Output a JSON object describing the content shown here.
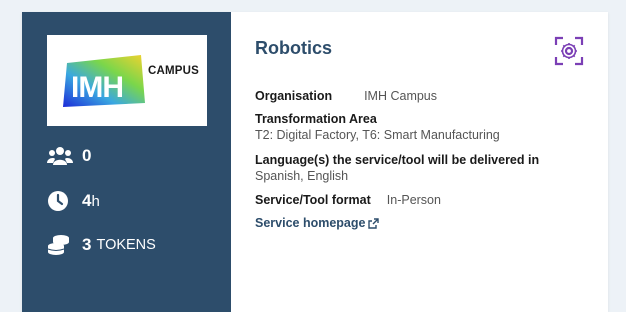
{
  "logo": {
    "letters": "IMH",
    "campus_text": "CAMPUS"
  },
  "stats": {
    "participants": "0",
    "duration_value": "4",
    "duration_unit": "h",
    "tokens_value": "3",
    "tokens_label": "TOKENS"
  },
  "title": "Robotics",
  "fields": {
    "organisation_label": "Organisation",
    "organisation_value": "IMH Campus",
    "area_label": "Transformation Area",
    "area_value": "T2: Digital Factory, T6: Smart Manufacturing",
    "language_label": "Language(s) the service/tool will be delivered in",
    "language_value": "Spanish, English",
    "format_label": "Service/Tool format",
    "format_value": "In-Person"
  },
  "homepage_link": "Service homepage",
  "colors": {
    "sidebar": "#2d4d6b",
    "title": "#2d4d6b",
    "scan_icon": "#7b3fb5",
    "background": "#edf2f7"
  },
  "icons": [
    "users-icon",
    "clock-icon",
    "coins-icon",
    "scan-settings-icon",
    "external-link-icon"
  ]
}
